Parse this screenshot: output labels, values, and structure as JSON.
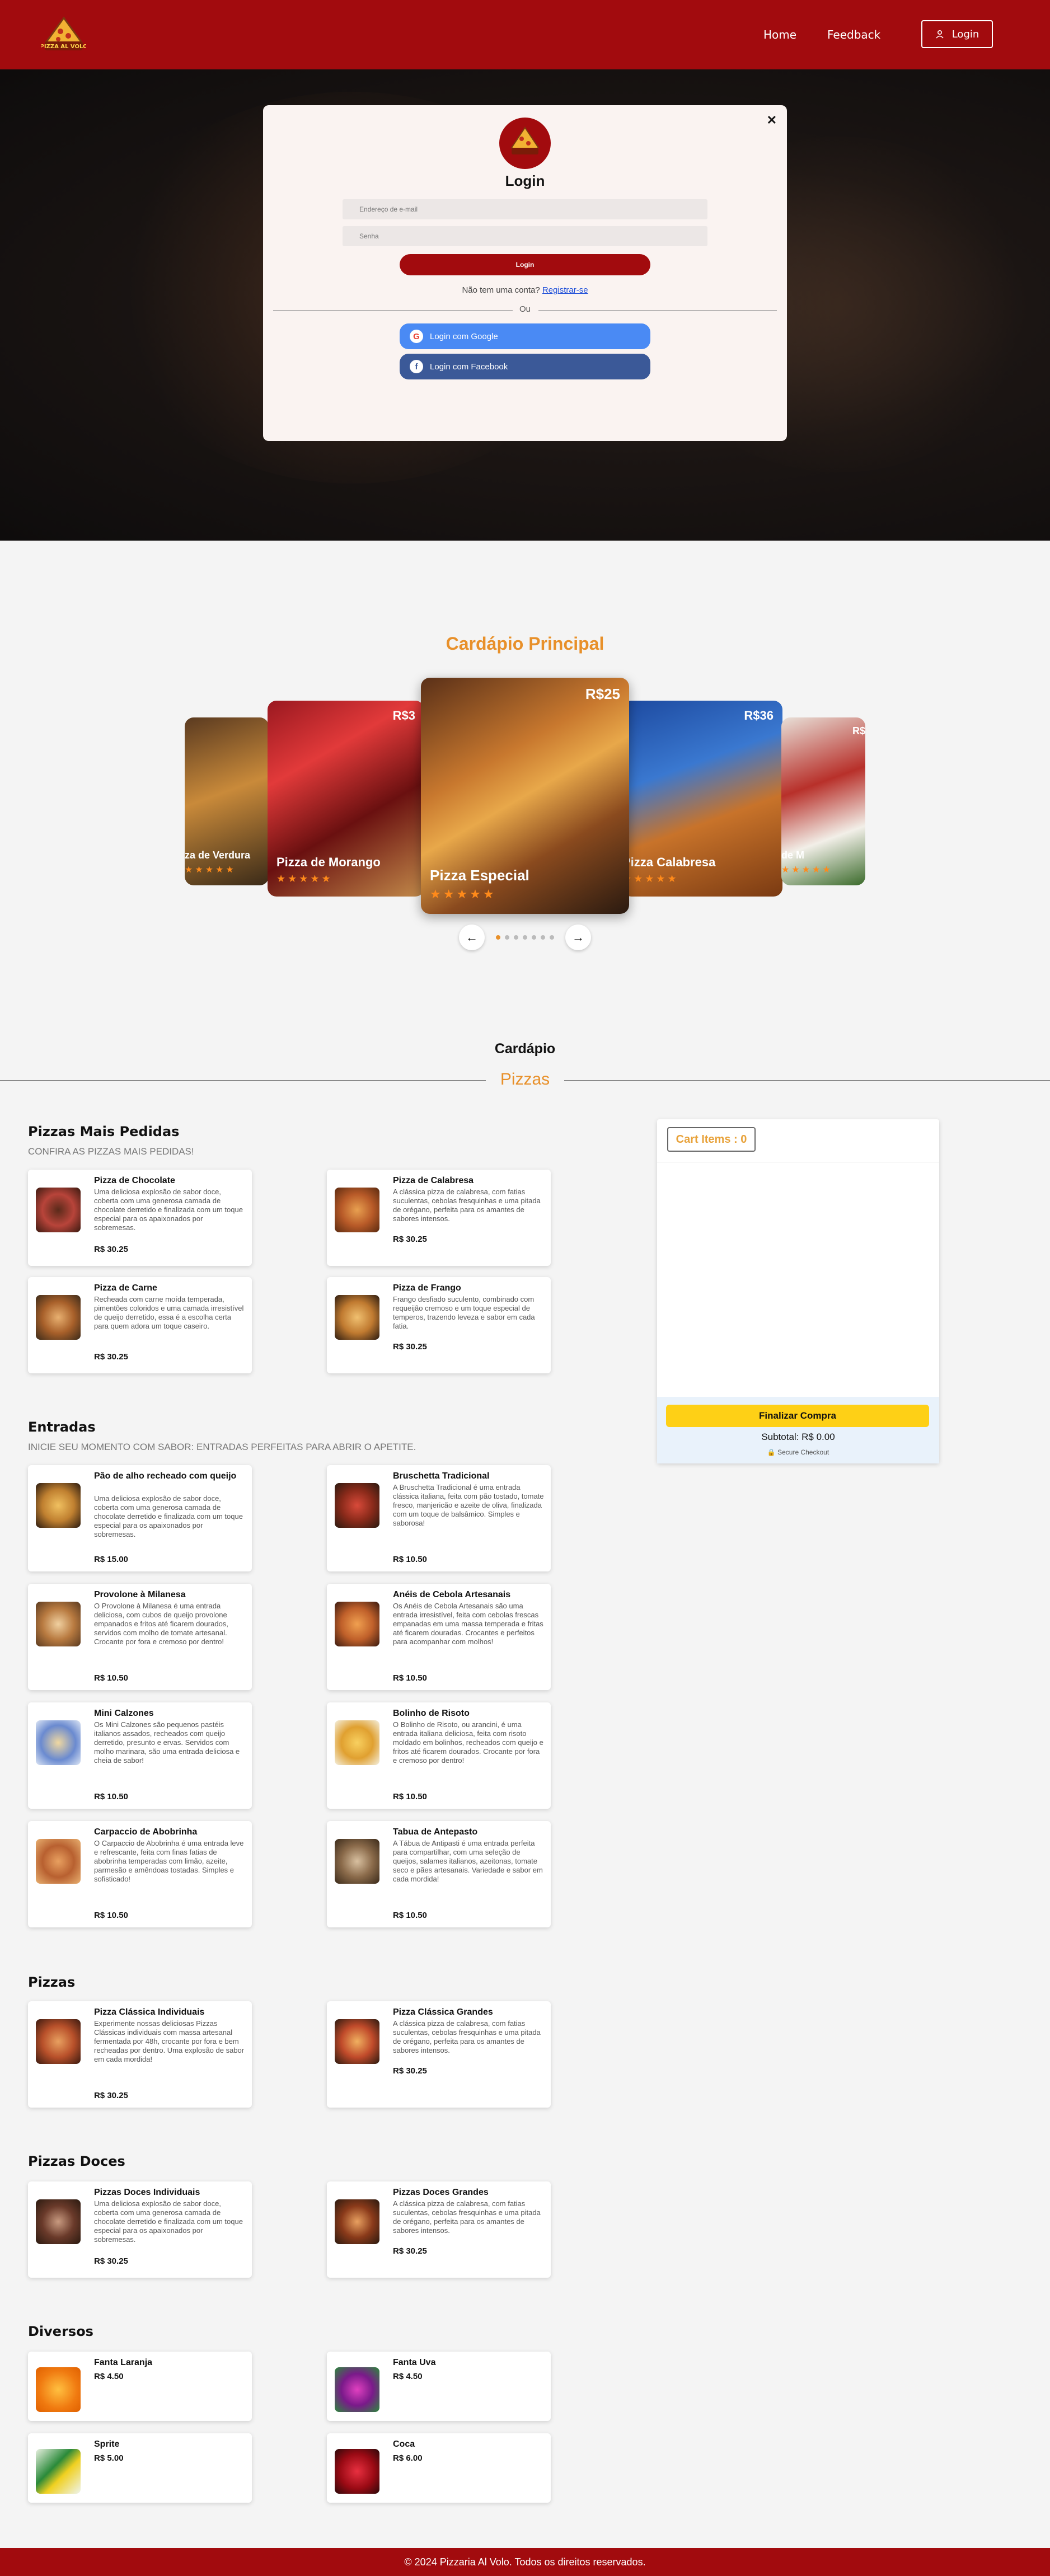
{
  "header": {
    "logo_text": "PIZZA AL VOLO",
    "nav": [
      "Home",
      "Feedback"
    ],
    "login_label": "Login"
  },
  "login_modal": {
    "close": "✕",
    "title": "Login",
    "email_placeholder": "Endereço de e-mail",
    "password_placeholder": "Senha",
    "submit_label": "Login",
    "register_prompt": "Não tem uma conta?",
    "register_link": "Registrar-se",
    "or_label": "Ou",
    "google_label": "Login com Google",
    "facebook_label": "Login com Facebook"
  },
  "carousel": {
    "title": "Cardápio Principal",
    "prev_icon": "←",
    "next_icon": "→",
    "cards": [
      {
        "name": "za de Verdura",
        "price": "",
        "stars": "★★★★★"
      },
      {
        "name": "Pizza de Morango",
        "price": "R$3",
        "stars": "★★★★★"
      },
      {
        "name": "Pizza Especial",
        "price": "R$25",
        "stars": "★★★★★"
      },
      {
        "name": "Pizza Calabresa",
        "price": "R$36",
        "stars": "★★★★★"
      },
      {
        "name": "de M",
        "price": "R$",
        "stars": "★★★★★"
      }
    ]
  },
  "menu": {
    "heading": "Cardápio",
    "subheading": "Pizzas",
    "categories": [
      {
        "title": "Pizzas Mais Pedidas",
        "subtitle": "CONFIRA AS PIZZAS MAIS PEDIDAS!",
        "items": [
          {
            "name": "Pizza de Chocolate",
            "desc": "Uma deliciosa explosão de sabor doce, coberta com uma generosa camada de chocolate derretido e finalizada com um toque especial para os apaixonados por sobremesas.",
            "price": "R$ 30.25"
          },
          {
            "name": "Pizza de Calabresa",
            "desc": "A clássica pizza de calabresa, com fatias suculentas, cebolas fresquinhas e uma pitada de orégano, perfeita para os amantes de sabores intensos.",
            "price": "R$ 30.25"
          },
          {
            "name": "Pizza de Carne",
            "desc": "Recheada com carne moída temperada, pimentões coloridos e uma camada irresistível de queijo derretido, essa é a escolha certa para quem adora um toque caseiro.",
            "price": "R$ 30.25"
          },
          {
            "name": "Pizza de Frango",
            "desc": "Frango desfiado suculento, combinado com requeijão cremoso e um toque especial de temperos, trazendo leveza e sabor em cada fatia.",
            "price": "R$ 30.25"
          }
        ]
      },
      {
        "title": "Entradas",
        "subtitle": "INICIE SEU MOMENTO COM SABOR: ENTRADAS PERFEITAS PARA ABRIR O APETITE.",
        "items": [
          {
            "name": "Pão de alho recheado com queijo",
            "desc": "Uma deliciosa explosão de sabor doce, coberta com uma generosa camada de chocolate derretido e finalizada com um toque especial para os apaixonados por sobremesas.",
            "price": "R$ 15.00"
          },
          {
            "name": "Bruschetta Tradicional",
            "desc": "A Bruschetta Tradicional é uma entrada clássica italiana, feita com pão tostado, tomate fresco, manjericão e azeite de oliva, finalizada com um toque de balsâmico. Simples e saborosa!",
            "price": "R$ 10.50"
          },
          {
            "name": "Provolone à Milanesa",
            "desc": "O Provolone à Milanesa é uma entrada deliciosa, com cubos de queijo provolone empanados e fritos até ficarem dourados, servidos com molho de tomate artesanal. Crocante por fora e cremoso por dentro!",
            "price": "R$ 10.50"
          },
          {
            "name": "Anéis de Cebola Artesanais",
            "desc": "Os Anéis de Cebola Artesanais são uma entrada irresistível, feita com cebolas frescas empanadas em uma massa temperada e fritas até ficarem douradas. Crocantes e perfeitos para acompanhar com molhos!",
            "price": "R$ 10.50"
          },
          {
            "name": "Mini Calzones",
            "desc": "Os Mini Calzones são pequenos pastéis italianos assados, recheados com queijo derretido, presunto e ervas. Servidos com molho marinara, são uma entrada deliciosa e cheia de sabor!",
            "price": "R$ 10.50"
          },
          {
            "name": "Bolinho de Risoto",
            "desc": "O Bolinho de Risoto, ou arancini, é uma entrada italiana deliciosa, feita com risoto moldado em bolinhos, recheados com queijo e fritos até ficarem dourados. Crocante por fora e cremoso por dentro!",
            "price": "R$ 10.50"
          },
          {
            "name": "Carpaccio de Abobrinha",
            "desc": "O Carpaccio de Abobrinha é uma entrada leve e refrescante, feita com finas fatias de abobrinha temperadas com limão, azeite, parmesão e amêndoas tostadas. Simples e sofisticado!",
            "price": "R$ 10.50"
          },
          {
            "name": "Tabua de Antepasto",
            "desc": "A Tábua de Antipasti é uma entrada perfeita para compartilhar, com uma seleção de queijos, salames italianos, azeitonas, tomate seco e pães artesanais. Variedade e sabor em cada mordida!",
            "price": "R$ 10.50"
          }
        ]
      },
      {
        "title": "Pizzas",
        "subtitle": "",
        "items": [
          {
            "name": "Pizza Clássica Individuais",
            "desc": "Experimente nossas deliciosas Pizzas Clássicas individuais com massa artesanal fermentada por 48h, crocante por fora e bem recheadas por dentro. Uma explosão de sabor em cada mordida!",
            "price": "R$ 30.25"
          },
          {
            "name": "Pizza Clássica Grandes",
            "desc": "A clássica pizza de calabresa, com fatias suculentas, cebolas fresquinhas e uma pitada de orégano, perfeita para os amantes de sabores intensos.",
            "price": "R$ 30.25"
          }
        ]
      },
      {
        "title": "Pizzas Doces",
        "subtitle": "",
        "items": [
          {
            "name": "Pizzas Doces Individuais",
            "desc": "Uma deliciosa explosão de sabor doce, coberta com uma generosa camada de chocolate derretido e finalizada com um toque especial para os apaixonados por sobremesas.",
            "price": "R$ 30.25"
          },
          {
            "name": "Pizzas Doces Grandes",
            "desc": "A clássica pizza de calabresa, com fatias suculentas, cebolas fresquinhas e uma pitada de orégano, perfeita para os amantes de sabores intensos.",
            "price": "R$ 30.25"
          }
        ]
      },
      {
        "title": "Diversos",
        "subtitle": "",
        "items": [
          {
            "name": "Fanta Laranja",
            "desc": "",
            "price": "R$ 4.50"
          },
          {
            "name": "Fanta Uva",
            "desc": "",
            "price": "R$ 4.50"
          },
          {
            "name": "Sprite",
            "desc": "",
            "price": "R$ 5.00"
          },
          {
            "name": "Coca",
            "desc": "",
            "price": "R$ 6.00"
          }
        ]
      }
    ]
  },
  "cart": {
    "header": "Cart Items : 0",
    "checkout_label": "Finalizar Compra",
    "subtotal": "Subtotal:  R$ 0.00",
    "secure": "🔒 Secure Checkout"
  },
  "footer": {
    "text": "© 2024 Pizzaria Al Volo. Todos os direitos reservados."
  },
  "colors": {
    "brand_red": "#a20b0e",
    "accent_orange": "#e8902a",
    "checkout_yellow": "#fed016",
    "google_blue": "#4a8af4",
    "facebook_blue": "#3b5998"
  }
}
